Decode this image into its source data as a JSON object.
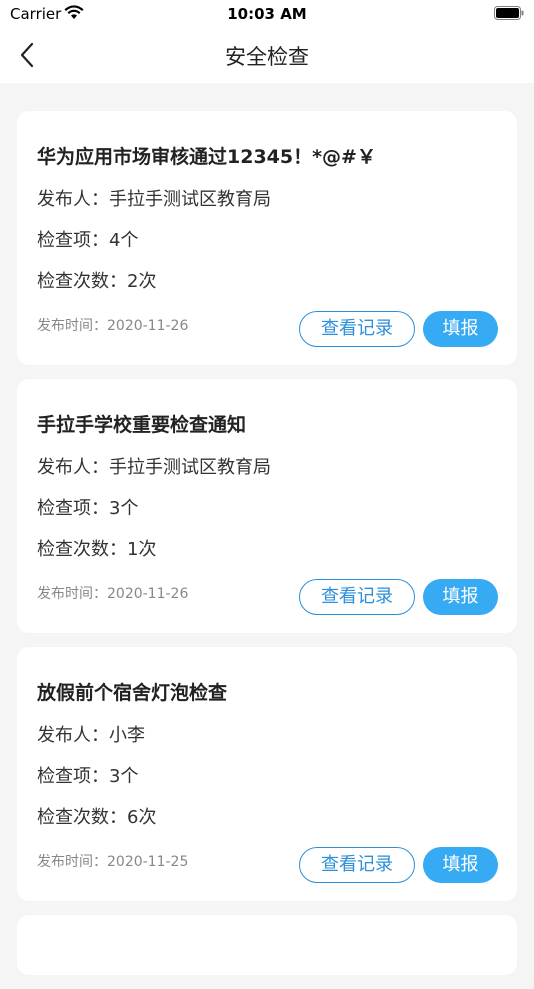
{
  "status_bar": {
    "carrier": "Carrier",
    "time": "10:03 AM"
  },
  "nav": {
    "title": "安全检查"
  },
  "labels": {
    "publisher": "发布人：",
    "items": "检查项：",
    "times": "检查次数：",
    "date_prefix": "发布时间：",
    "view_button": "查看记录",
    "fill_button": "填报"
  },
  "cards": [
    {
      "title": "华为应用市场审核通过12345！*@#￥",
      "publisher": "手拉手测试区教育局",
      "items": "4个",
      "times": "2次",
      "date": "2020-11-26"
    },
    {
      "title": "手拉手学校重要检查通知",
      "publisher": "手拉手测试区教育局",
      "items": "3个",
      "times": "1次",
      "date": "2020-11-26"
    },
    {
      "title": "放假前个宿舍灯泡检查",
      "publisher": "小李",
      "items": "3个",
      "times": "6次",
      "date": "2020-11-25"
    }
  ],
  "colors": {
    "accent": "#36aaf2",
    "outline": "#2b8fd9",
    "background": "#f5f5f5"
  }
}
